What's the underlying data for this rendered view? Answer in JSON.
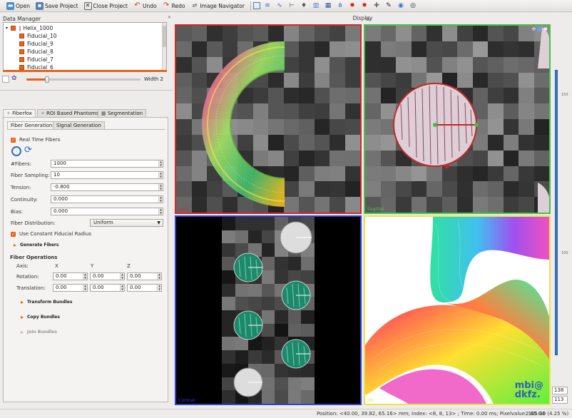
{
  "toolbar": {
    "open": "Open",
    "save_project": "Save Project",
    "close_project": "Close Project",
    "undo": "Undo",
    "redo": "Redo",
    "image_navigator": "Image Navigator"
  },
  "data_manager": {
    "title": "Data Manager",
    "items": [
      {
        "label": "Helix_1000"
      },
      {
        "label": "Fiducial_10"
      },
      {
        "label": "Fiducial_9"
      },
      {
        "label": "Fiducial_8"
      },
      {
        "label": "Fiducial_7"
      },
      {
        "label": "Fiducial_6"
      }
    ],
    "width_label": "Width 2",
    "width_fraction": 0.18
  },
  "plugin_tabs": [
    "Fiberfox",
    "ROI Based Phantoms",
    "Segmentation"
  ],
  "sub_tabs": [
    "Fiber Generation",
    "Signal Generation"
  ],
  "fiber_generation": {
    "real_time_fibers": "Real Time Fibers",
    "fields": [
      {
        "label": "#Fibers:",
        "value": "1000"
      },
      {
        "label": "Fiber Sampling:",
        "value": "10"
      },
      {
        "label": "Tension:",
        "value": "-0.800"
      },
      {
        "label": "Continuity:",
        "value": "0.000"
      },
      {
        "label": "Bias:",
        "value": "0.000"
      }
    ],
    "distribution_label": "Fiber Distribution:",
    "distribution_value": "Uniform",
    "constant_radius": "Use Constant Fiducial Radius",
    "generate_fibers": "Generate Fibers",
    "operations_title": "Fiber Operations",
    "axis_label": "Axis:",
    "axes": [
      "X",
      "Y",
      "Z"
    ],
    "rotation_label": "Rotation:",
    "rotation": [
      "0.00",
      "0.00",
      "0.00"
    ],
    "translation_label": "Translation:",
    "translation": [
      "0.00",
      "0.00",
      "0.00"
    ],
    "transform_bundles": "Transform Bundles",
    "copy_bundles": "Copy Bundles",
    "join_bundles": "Join Bundles"
  },
  "display": {
    "title": "Display",
    "views": [
      {
        "name": "Axial",
        "border_color": "#d32a2a"
      },
      {
        "name": "Sagittal",
        "border_color": "#47c247"
      },
      {
        "name": "Coronal",
        "border_color": "#3040d8"
      },
      {
        "name": "3D",
        "border_color": "#e6e64b"
      }
    ],
    "logo_line1": "mbi@",
    "logo_line2": "dkfz."
  },
  "slice_slider": {
    "tick_top": "150",
    "tick_bottom": "100",
    "slice_value": "138",
    "total_value": "113"
  },
  "status": {
    "text": "Position: <40.00, 39.82, 65.16> mm; Index: <8, 8, 13> ; Time: 0.00 ms; Pixelvalue: 105.00",
    "memory": "2.65 GB (4.25 %)"
  }
}
